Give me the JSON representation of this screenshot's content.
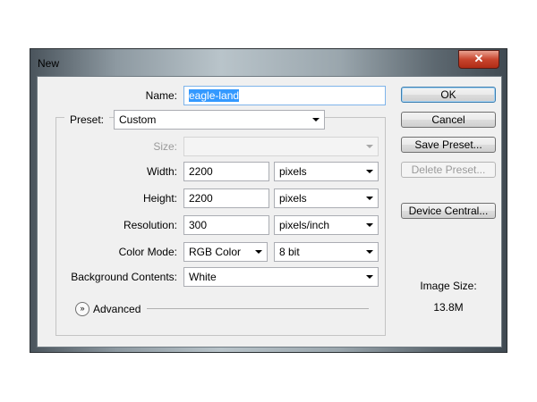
{
  "window": {
    "title": "New",
    "close_glyph": "✕"
  },
  "form": {
    "name_label": "Name:",
    "name_value": "eagle-land",
    "preset_label": "Preset:",
    "preset_value": "Custom",
    "size_label": "Size:",
    "size_value": "",
    "width_label": "Width:",
    "width_value": "2200",
    "width_unit": "pixels",
    "height_label": "Height:",
    "height_value": "2200",
    "height_unit": "pixels",
    "resolution_label": "Resolution:",
    "resolution_value": "300",
    "resolution_unit": "pixels/inch",
    "color_mode_label": "Color Mode:",
    "color_mode_value": "RGB Color",
    "bit_depth_value": "8 bit",
    "background_label": "Background Contents:",
    "background_value": "White",
    "advanced_label": "Advanced",
    "advanced_icon": "expand-chevrons-icon"
  },
  "buttons": {
    "ok": "OK",
    "cancel": "Cancel",
    "save_preset": "Save Preset...",
    "delete_preset": "Delete Preset...",
    "device_central": "Device Central..."
  },
  "image_size": {
    "label": "Image Size:",
    "value": "13.8M"
  },
  "colors": {
    "selection": "#3399ff",
    "default_button_border": "#3c7fb1",
    "close_button": "#c8452e"
  }
}
